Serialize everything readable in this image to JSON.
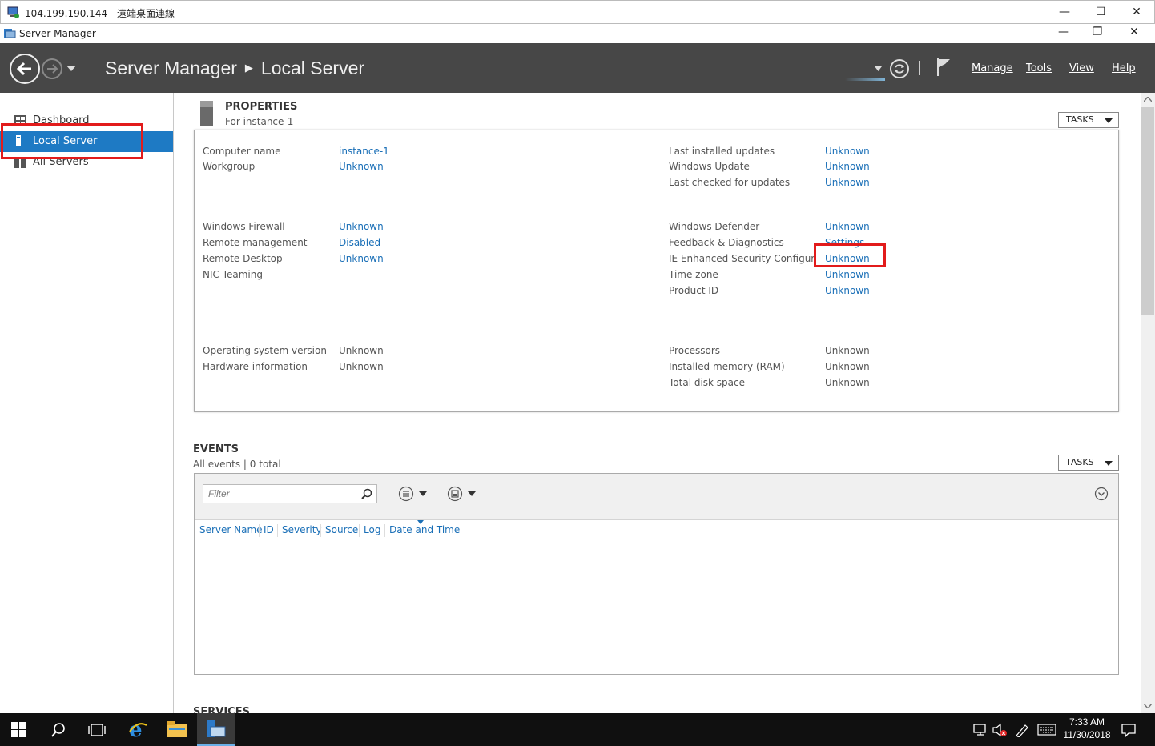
{
  "rdp_window": {
    "title": "104.199.190.144 - 遠端桌面連線"
  },
  "app_window": {
    "title": "Server Manager"
  },
  "header": {
    "breadcrumb_app": "Server Manager",
    "breadcrumb_page": "Local Server",
    "menus": [
      "Manage",
      "Tools",
      "View",
      "Help"
    ]
  },
  "sidebar": {
    "items": [
      {
        "label": "Dashboard",
        "active": false
      },
      {
        "label": "Local Server",
        "active": true
      },
      {
        "label": "All Servers",
        "active": false
      }
    ]
  },
  "properties": {
    "title": "PROPERTIES",
    "subtitle": "For instance-1",
    "tasks_label": "TASKS",
    "left_group_1": [
      {
        "label": "Computer name",
        "value": "instance-1"
      },
      {
        "label": "Workgroup",
        "value": "Unknown"
      }
    ],
    "left_group_2": [
      {
        "label": "Windows Firewall",
        "value": "Unknown"
      },
      {
        "label": "Remote management",
        "value": "Disabled"
      },
      {
        "label": "Remote Desktop",
        "value": "Unknown"
      },
      {
        "label": "NIC Teaming",
        "value": ""
      }
    ],
    "left_group_3": [
      {
        "label": "Operating system version",
        "value": "Unknown"
      },
      {
        "label": "Hardware information",
        "value": "Unknown"
      }
    ],
    "right_group_1": [
      {
        "label": "Last installed updates",
        "value": "Unknown"
      },
      {
        "label": "Windows Update",
        "value": "Unknown"
      },
      {
        "label": "Last checked for updates",
        "value": "Unknown"
      }
    ],
    "right_group_2": [
      {
        "label": "Windows Defender",
        "value": "Unknown"
      },
      {
        "label": "Feedback & Diagnostics",
        "value": "Settings"
      },
      {
        "label": "IE Enhanced Security Configuration",
        "value": "Unknown"
      },
      {
        "label": "Time zone",
        "value": "Unknown"
      },
      {
        "label": "Product ID",
        "value": "Unknown"
      }
    ],
    "right_group_3": [
      {
        "label": "Processors",
        "value": "Unknown"
      },
      {
        "label": "Installed memory (RAM)",
        "value": "Unknown"
      },
      {
        "label": "Total disk space",
        "value": "Unknown"
      }
    ]
  },
  "events": {
    "title": "EVENTS",
    "subtitle": "All events | 0 total",
    "tasks_label": "TASKS",
    "filter_placeholder": "Filter",
    "columns": [
      "Server Name",
      "ID",
      "Severity",
      "Source",
      "Log",
      "Date and Time"
    ]
  },
  "services": {
    "title": "SERVICES"
  },
  "taskbar": {
    "time": "7:33 AM",
    "date": "11/30/2018"
  },
  "colors": {
    "header_bg": "#474747",
    "accent": "#1e7ac4",
    "link": "#1a6fb7",
    "highlight": "#e21b1b"
  }
}
